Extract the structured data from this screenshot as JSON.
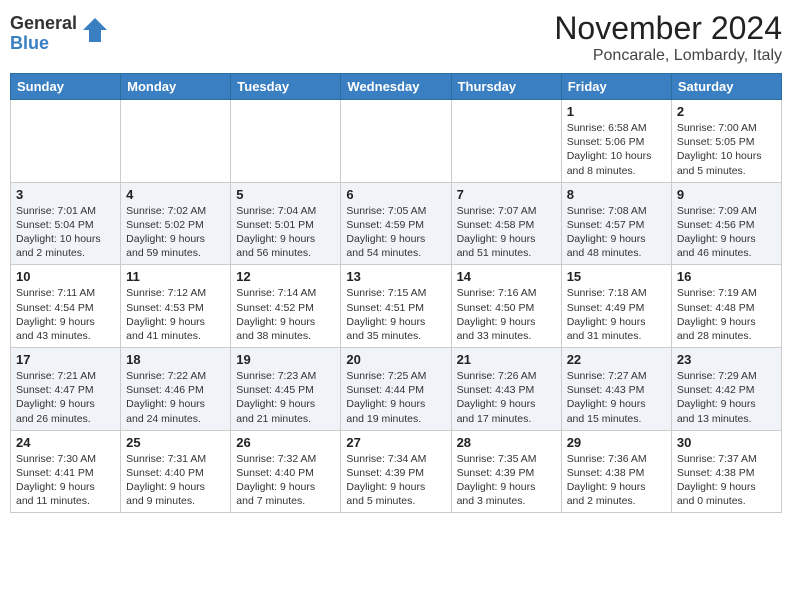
{
  "header": {
    "logo_general": "General",
    "logo_blue": "Blue",
    "title": "November 2024",
    "subtitle": "Poncarale, Lombardy, Italy"
  },
  "days_of_week": [
    "Sunday",
    "Monday",
    "Tuesday",
    "Wednesday",
    "Thursday",
    "Friday",
    "Saturday"
  ],
  "weeks": [
    [
      {
        "day": "",
        "info": ""
      },
      {
        "day": "",
        "info": ""
      },
      {
        "day": "",
        "info": ""
      },
      {
        "day": "",
        "info": ""
      },
      {
        "day": "",
        "info": ""
      },
      {
        "day": "1",
        "info": "Sunrise: 6:58 AM\nSunset: 5:06 PM\nDaylight: 10 hours and 8 minutes."
      },
      {
        "day": "2",
        "info": "Sunrise: 7:00 AM\nSunset: 5:05 PM\nDaylight: 10 hours and 5 minutes."
      }
    ],
    [
      {
        "day": "3",
        "info": "Sunrise: 7:01 AM\nSunset: 5:04 PM\nDaylight: 10 hours and 2 minutes."
      },
      {
        "day": "4",
        "info": "Sunrise: 7:02 AM\nSunset: 5:02 PM\nDaylight: 9 hours and 59 minutes."
      },
      {
        "day": "5",
        "info": "Sunrise: 7:04 AM\nSunset: 5:01 PM\nDaylight: 9 hours and 56 minutes."
      },
      {
        "day": "6",
        "info": "Sunrise: 7:05 AM\nSunset: 4:59 PM\nDaylight: 9 hours and 54 minutes."
      },
      {
        "day": "7",
        "info": "Sunrise: 7:07 AM\nSunset: 4:58 PM\nDaylight: 9 hours and 51 minutes."
      },
      {
        "day": "8",
        "info": "Sunrise: 7:08 AM\nSunset: 4:57 PM\nDaylight: 9 hours and 48 minutes."
      },
      {
        "day": "9",
        "info": "Sunrise: 7:09 AM\nSunset: 4:56 PM\nDaylight: 9 hours and 46 minutes."
      }
    ],
    [
      {
        "day": "10",
        "info": "Sunrise: 7:11 AM\nSunset: 4:54 PM\nDaylight: 9 hours and 43 minutes."
      },
      {
        "day": "11",
        "info": "Sunrise: 7:12 AM\nSunset: 4:53 PM\nDaylight: 9 hours and 41 minutes."
      },
      {
        "day": "12",
        "info": "Sunrise: 7:14 AM\nSunset: 4:52 PM\nDaylight: 9 hours and 38 minutes."
      },
      {
        "day": "13",
        "info": "Sunrise: 7:15 AM\nSunset: 4:51 PM\nDaylight: 9 hours and 35 minutes."
      },
      {
        "day": "14",
        "info": "Sunrise: 7:16 AM\nSunset: 4:50 PM\nDaylight: 9 hours and 33 minutes."
      },
      {
        "day": "15",
        "info": "Sunrise: 7:18 AM\nSunset: 4:49 PM\nDaylight: 9 hours and 31 minutes."
      },
      {
        "day": "16",
        "info": "Sunrise: 7:19 AM\nSunset: 4:48 PM\nDaylight: 9 hours and 28 minutes."
      }
    ],
    [
      {
        "day": "17",
        "info": "Sunrise: 7:21 AM\nSunset: 4:47 PM\nDaylight: 9 hours and 26 minutes."
      },
      {
        "day": "18",
        "info": "Sunrise: 7:22 AM\nSunset: 4:46 PM\nDaylight: 9 hours and 24 minutes."
      },
      {
        "day": "19",
        "info": "Sunrise: 7:23 AM\nSunset: 4:45 PM\nDaylight: 9 hours and 21 minutes."
      },
      {
        "day": "20",
        "info": "Sunrise: 7:25 AM\nSunset: 4:44 PM\nDaylight: 9 hours and 19 minutes."
      },
      {
        "day": "21",
        "info": "Sunrise: 7:26 AM\nSunset: 4:43 PM\nDaylight: 9 hours and 17 minutes."
      },
      {
        "day": "22",
        "info": "Sunrise: 7:27 AM\nSunset: 4:43 PM\nDaylight: 9 hours and 15 minutes."
      },
      {
        "day": "23",
        "info": "Sunrise: 7:29 AM\nSunset: 4:42 PM\nDaylight: 9 hours and 13 minutes."
      }
    ],
    [
      {
        "day": "24",
        "info": "Sunrise: 7:30 AM\nSunset: 4:41 PM\nDaylight: 9 hours and 11 minutes."
      },
      {
        "day": "25",
        "info": "Sunrise: 7:31 AM\nSunset: 4:40 PM\nDaylight: 9 hours and 9 minutes."
      },
      {
        "day": "26",
        "info": "Sunrise: 7:32 AM\nSunset: 4:40 PM\nDaylight: 9 hours and 7 minutes."
      },
      {
        "day": "27",
        "info": "Sunrise: 7:34 AM\nSunset: 4:39 PM\nDaylight: 9 hours and 5 minutes."
      },
      {
        "day": "28",
        "info": "Sunrise: 7:35 AM\nSunset: 4:39 PM\nDaylight: 9 hours and 3 minutes."
      },
      {
        "day": "29",
        "info": "Sunrise: 7:36 AM\nSunset: 4:38 PM\nDaylight: 9 hours and 2 minutes."
      },
      {
        "day": "30",
        "info": "Sunrise: 7:37 AM\nSunset: 4:38 PM\nDaylight: 9 hours and 0 minutes."
      }
    ]
  ]
}
